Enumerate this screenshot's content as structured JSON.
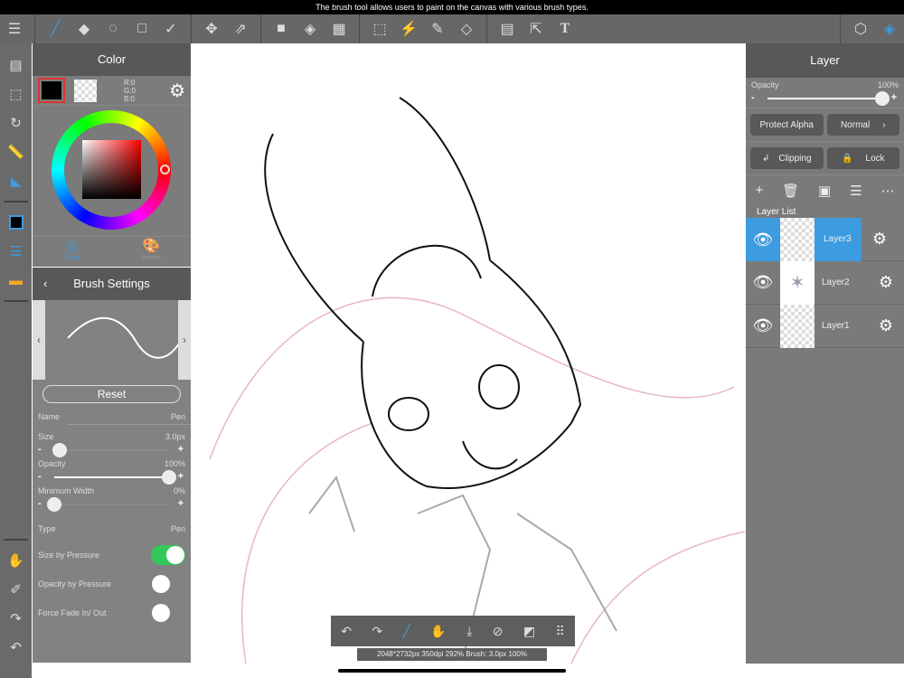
{
  "tip": "The brush tool allows users to paint on the canvas with various brush types.",
  "toolbar": {
    "icons": [
      "menu-icon",
      "brush-icon",
      "eraser-icon",
      "blur-icon",
      "rectangle-icon",
      "vector-icon",
      "move-icon",
      "transform-icon",
      "fill-color-icon",
      "bucket-icon",
      "gradient-icon",
      "select-rect-icon",
      "magic-wand-icon",
      "select-pen-icon",
      "select-eraser-icon",
      "frame-icon",
      "select-layer-icon",
      "text-icon",
      "materials-icon",
      "layers-icon"
    ]
  },
  "color_panel": {
    "title": "Color",
    "rgb": {
      "r": "R:0",
      "g": "G:0",
      "b": "B:0"
    },
    "tabs": [
      "Color",
      "Palette"
    ],
    "primary": "#000000"
  },
  "brush": {
    "title": "Brush Settings",
    "reset": "Reset",
    "name_label": "Name",
    "name_value": "Pen",
    "size_label": "Size",
    "size_value": "3.0px",
    "size_fraction": 0.05,
    "opacity_label": "Opacity",
    "opacity_value": "100%",
    "opacity_fraction": 1.0,
    "minwidth_label": "Minimum Width",
    "minwidth_value": "0%",
    "minwidth_fraction": 0.0,
    "type_label": "Type",
    "type_value": "Pen",
    "size_pressure": "Size by Pressure",
    "size_pressure_on": true,
    "opacity_pressure": "Opacity by Pressure",
    "opacity_pressure_on": false,
    "fade": "Force Fade In/ Out",
    "fade_on": false
  },
  "layer_panel": {
    "title": "Layer",
    "opacity_label": "Opacity",
    "opacity_value": "100%",
    "protect_alpha": "Protect Alpha",
    "blend": "Normal",
    "clipping": "Clipping",
    "lock": "Lock",
    "list_label": "Layer List",
    "layers": [
      {
        "name": "Layer3",
        "selected": true
      },
      {
        "name": "Layer2",
        "selected": false
      },
      {
        "name": "Layer1",
        "selected": false
      }
    ]
  },
  "status": "2048*2732px 350dpi 292% Brush: 3.0px 100%",
  "colors": {
    "accent": "#3d9be0",
    "toggle_on": "#34c759"
  }
}
